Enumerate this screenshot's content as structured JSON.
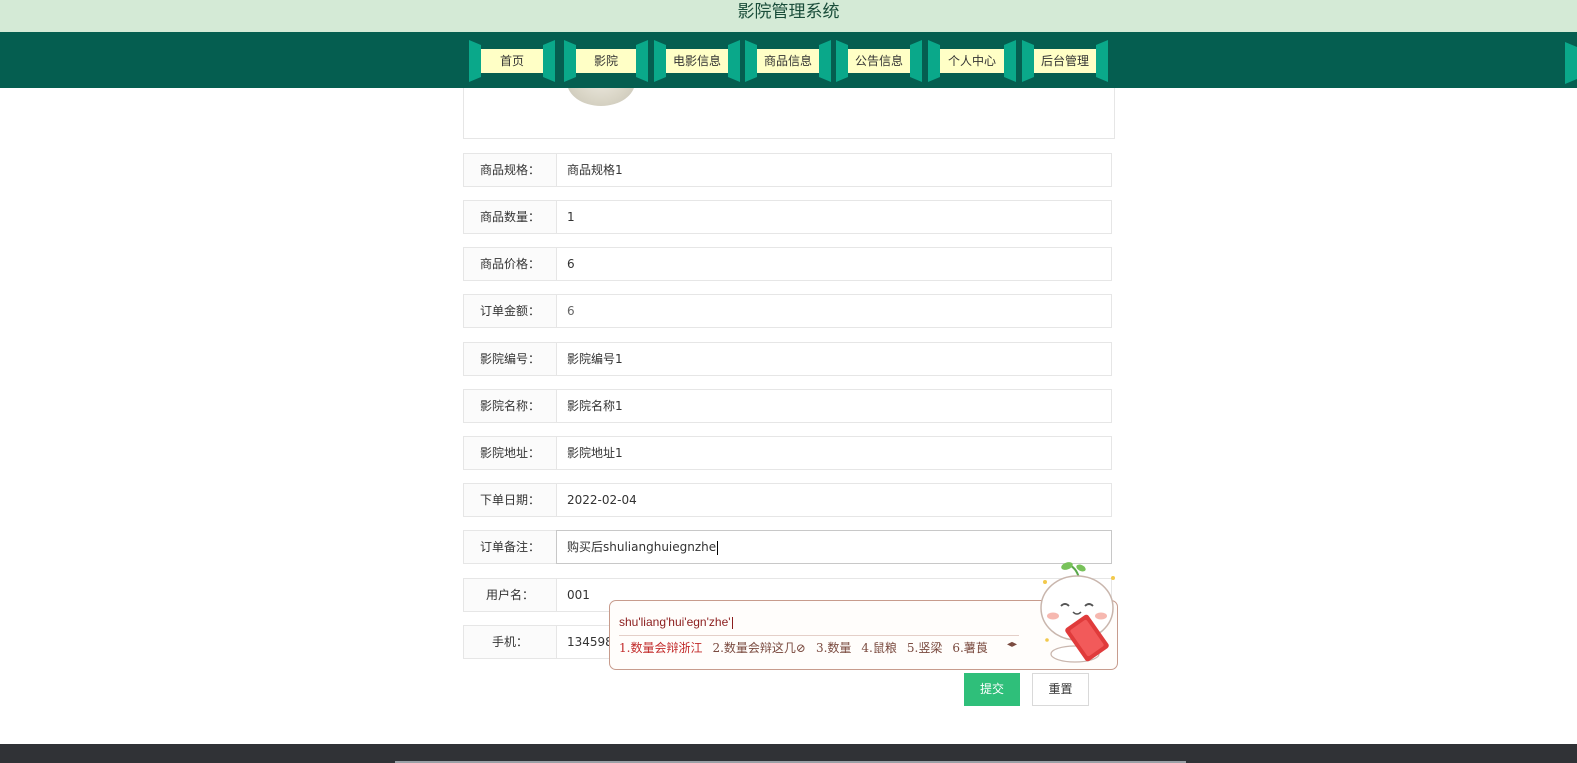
{
  "header": {
    "title": "影院管理系统"
  },
  "nav": {
    "items": [
      {
        "label": "首页"
      },
      {
        "label": "影院"
      },
      {
        "label": "电影信息"
      },
      {
        "label": "商品信息"
      },
      {
        "label": "公告信息"
      },
      {
        "label": "个人中心"
      },
      {
        "label": "后台管理"
      }
    ]
  },
  "form": {
    "fields": [
      {
        "label": "商品规格：",
        "value": "商品规格1"
      },
      {
        "label": "商品数量：",
        "value": "1"
      },
      {
        "label": "商品价格：",
        "value": "6"
      },
      {
        "label": "订单金额：",
        "value": "6"
      },
      {
        "label": "影院编号：",
        "value": "影院编号1"
      },
      {
        "label": "影院名称：",
        "value": "影院名称1"
      },
      {
        "label": "影院地址：",
        "value": "影院地址1"
      },
      {
        "label": "下单日期：",
        "value": "2022-02-04"
      },
      {
        "label": "订单备注：",
        "value": "购买后shulianghuiegnzhe"
      },
      {
        "label": "用户名：",
        "value": "001"
      },
      {
        "label": "手机：",
        "value": "1345987"
      }
    ],
    "submit_label": "提交",
    "reset_label": "重置"
  },
  "ime": {
    "composition": "shu'liang'hui'egn'zhe'",
    "candidates": [
      "1.数量会辩浙江",
      "2.数量会辩这几⊘",
      "3.数量",
      "4.鼠粮",
      "5.竖梁",
      "6.薯莨"
    ]
  },
  "colors": {
    "nav_bg": "#055e50",
    "title_bar_bg": "#d4ead6",
    "submit_bg": "#2fbf7a",
    "nav_label_bg": "#ffffc6"
  }
}
